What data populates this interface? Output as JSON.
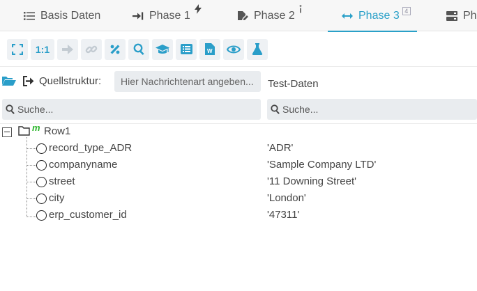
{
  "tabs": [
    {
      "label": "Basis Daten",
      "icon": "list-icon",
      "badge": ""
    },
    {
      "label": "Phase 1",
      "icon": "arrow-to-line-icon",
      "badge": "bolt-icon"
    },
    {
      "label": "Phase 2",
      "icon": "file-signature-icon",
      "badge": "info-icon"
    },
    {
      "label": "Phase 3",
      "icon": "arrows-horizontal-icon",
      "badge": "4"
    },
    {
      "label": "Ph",
      "icon": "server-icon",
      "badge": ""
    }
  ],
  "active_tab": "Phase 3",
  "toolbar": {
    "one_to_one_label": "1:1",
    "buttons": [
      "expand-icon",
      "one-to-one",
      "arrow-right-icon",
      "link-icon",
      "percent-icon",
      "search-icon",
      "graduation-cap-icon",
      "list-alt-icon",
      "word-file-icon",
      "eye-icon",
      "flask-icon"
    ]
  },
  "source": {
    "label": "Quellstruktur:",
    "placeholder": "Hier Nachrichtenart angeben...",
    "test_label": "Test-Daten"
  },
  "search": {
    "left_placeholder": "Suche...",
    "right_placeholder": "Suche..."
  },
  "tree": {
    "root": "Row1",
    "fields": [
      {
        "name": "record_type_ADR",
        "value": "'ADR'"
      },
      {
        "name": "companyname",
        "value": "'Sample Company LTD'"
      },
      {
        "name": "street",
        "value": "'11 Downing Street'"
      },
      {
        "name": "city",
        "value": "'London'"
      },
      {
        "name": "erp_customer_id",
        "value": "'47311'"
      }
    ]
  },
  "colors": {
    "accent": "#2aa0c8",
    "toolbar_bg": "#eef1f4",
    "input_bg": "#e9ecef",
    "mapping_badge": "#2bb52b"
  }
}
